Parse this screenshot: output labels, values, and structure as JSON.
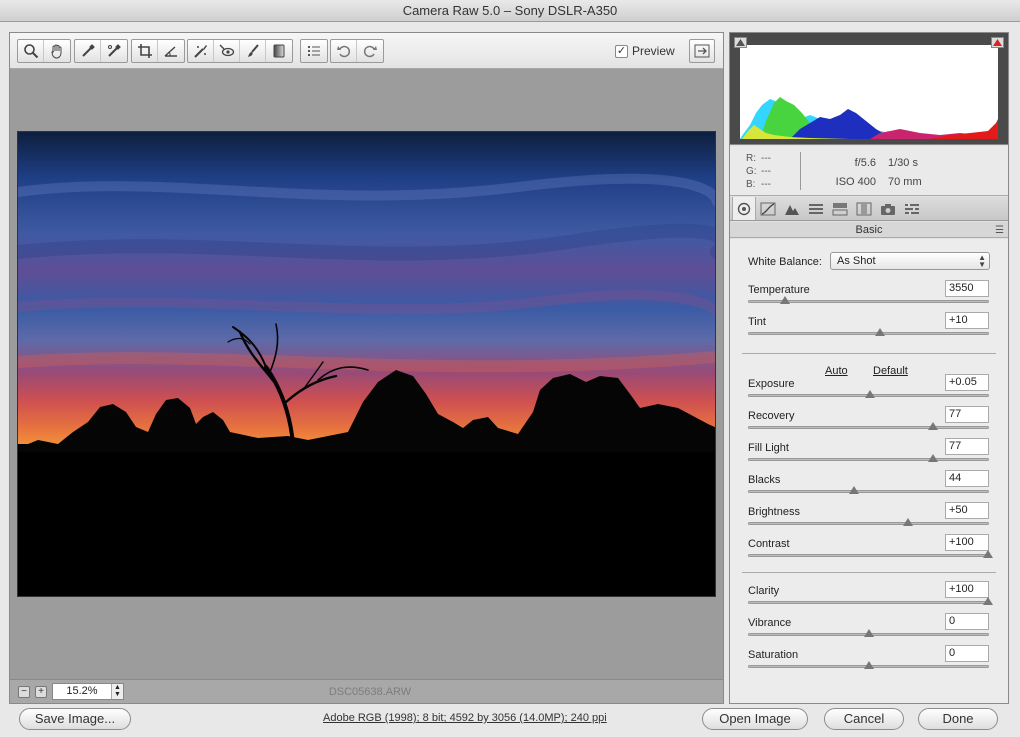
{
  "window": {
    "title": "Camera Raw 5.0  –  Sony DSLR-A350"
  },
  "toolbar": {
    "tools": [
      "zoom-tool",
      "hand-tool",
      "white-balance-tool",
      "color-sampler-tool",
      "crop-tool",
      "straighten-tool",
      "retouch-tool",
      "red-eye-tool",
      "adjustment-brush",
      "graduated-filter",
      "preferences",
      "rotate-ccw",
      "rotate-cw"
    ],
    "preview_label": "Preview",
    "preview_checked": "✓"
  },
  "statusbar": {
    "zoom_minus": "−",
    "zoom_plus": "+",
    "zoom": "15.2%",
    "filename": "DSC05638.ARW"
  },
  "info": {
    "r_label": "R:",
    "r_value": "---",
    "g_label": "G:",
    "g_value": "---",
    "b_label": "B:",
    "b_value": "---",
    "aperture": "f/5.6",
    "shutter": "1/30 s",
    "iso": "ISO 400",
    "focal_length": "70 mm"
  },
  "panel": {
    "section_title": "Basic"
  },
  "white_balance": {
    "label": "White Balance:",
    "value": "As Shot"
  },
  "auto_default": {
    "auto": "Auto",
    "default": "Default"
  },
  "sliders": {
    "temperature": {
      "label": "Temperature",
      "value": "3550",
      "position": 0.15
    },
    "tint": {
      "label": "Tint",
      "value": "+10",
      "position": 0.55
    },
    "exposure": {
      "label": "Exposure",
      "value": "+0.05",
      "position": 0.505
    },
    "recovery": {
      "label": "Recovery",
      "value": "77",
      "position": 0.77
    },
    "fill_light": {
      "label": "Fill Light",
      "value": "77",
      "position": 0.77
    },
    "blacks": {
      "label": "Blacks",
      "value": "44",
      "position": 0.44
    },
    "brightness": {
      "label": "Brightness",
      "value": "+50",
      "position": 0.665
    },
    "contrast": {
      "label": "Contrast",
      "value": "+100",
      "position": 1.0
    },
    "clarity": {
      "label": "Clarity",
      "value": "+100",
      "position": 1.0
    },
    "vibrance": {
      "label": "Vibrance",
      "value": "0",
      "position": 0.5
    },
    "saturation": {
      "label": "Saturation",
      "value": "0",
      "position": 0.5
    }
  },
  "bottom": {
    "save_image": "Save Image...",
    "workflow_options": "Adobe RGB (1998); 8 bit; 4592 by 3056 (14.0MP); 240 ppi",
    "open_image": "Open Image",
    "cancel": "Cancel",
    "done": "Done"
  }
}
